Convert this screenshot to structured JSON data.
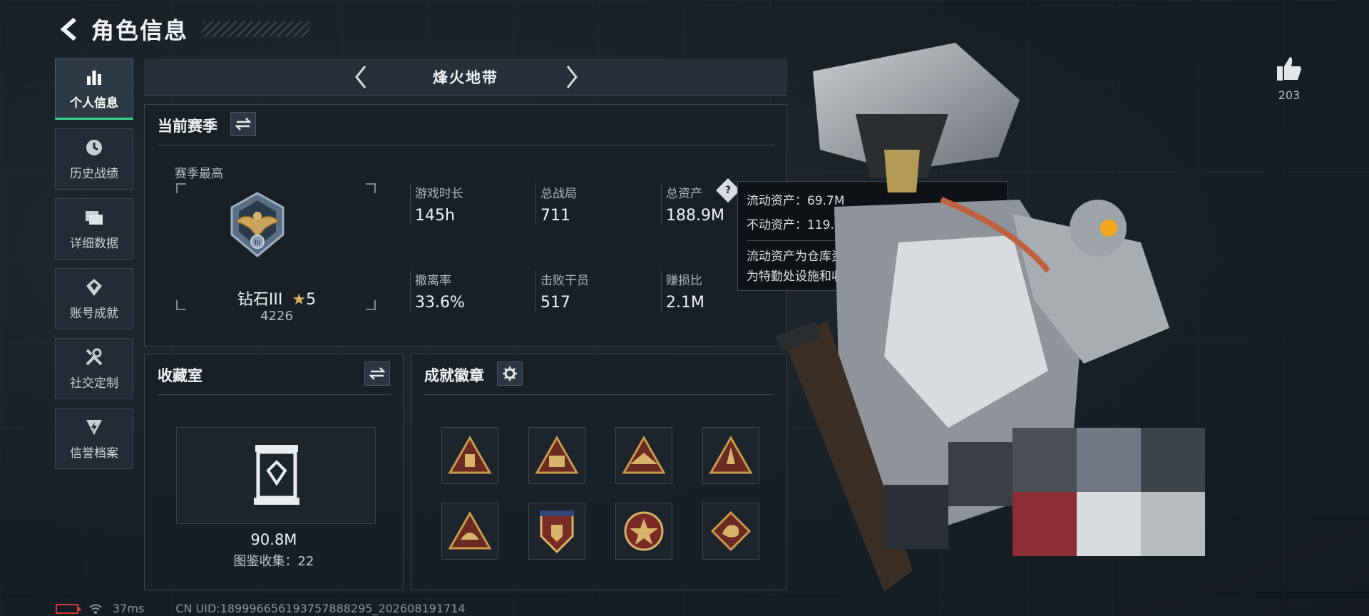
{
  "header": {
    "title": "角色信息"
  },
  "sidebar": {
    "items": [
      {
        "label": "个人信息",
        "icon": "bar-chart-icon",
        "active": true
      },
      {
        "label": "历史战绩",
        "icon": "clock-icon",
        "active": false
      },
      {
        "label": "详细数据",
        "icon": "folder-icon",
        "active": false
      },
      {
        "label": "账号成就",
        "icon": "trophy-icon",
        "active": false
      },
      {
        "label": "社交定制",
        "icon": "wrench-icon",
        "active": false
      },
      {
        "label": "信誉档案",
        "icon": "shield-bolt-icon",
        "active": false
      }
    ]
  },
  "map": {
    "name": "烽火地带"
  },
  "season": {
    "title": "当前赛季",
    "subtitle": "赛季最高",
    "rank_name": "钻石III",
    "rank_stars": "5",
    "rank_score": "4226",
    "stats": [
      {
        "label": "游戏时长",
        "value": "145h"
      },
      {
        "label": "总战局",
        "value": "711"
      },
      {
        "label": "总资产",
        "value": "188.9M"
      },
      {
        "label": "撤离率",
        "value": "33.6%"
      },
      {
        "label": "击败干员",
        "value": "517"
      },
      {
        "label": "赚损比",
        "value": "2.1M"
      }
    ]
  },
  "tooltip": {
    "liquid": "流动资产：69.7M",
    "fixed": "不动资产：119.1M",
    "desc_line1": "流动资产为仓库资产和哈夫币，不动资产",
    "desc_line2": "为特勤处设施和收藏室设施"
  },
  "collection": {
    "title": "收藏室",
    "value": "90.8M",
    "count": "图鉴收集：22"
  },
  "badges": {
    "title": "成就徽章",
    "items": [
      "triangle-badge-1",
      "triangle-badge-50",
      "triangle-badge-500",
      "triangle-badge-rocket",
      "triangle-badge-helmet",
      "shield-badge",
      "star-badge",
      "dragon-badge"
    ]
  },
  "like": {
    "count": "203"
  },
  "status": {
    "ping": "37ms",
    "uid": "CN UID:1899966561937578882​95_202608191714"
  },
  "colors": {
    "accent_green": "#36d68a",
    "panel_bg": "#181f26",
    "badge_gold": "#c99a4a"
  }
}
